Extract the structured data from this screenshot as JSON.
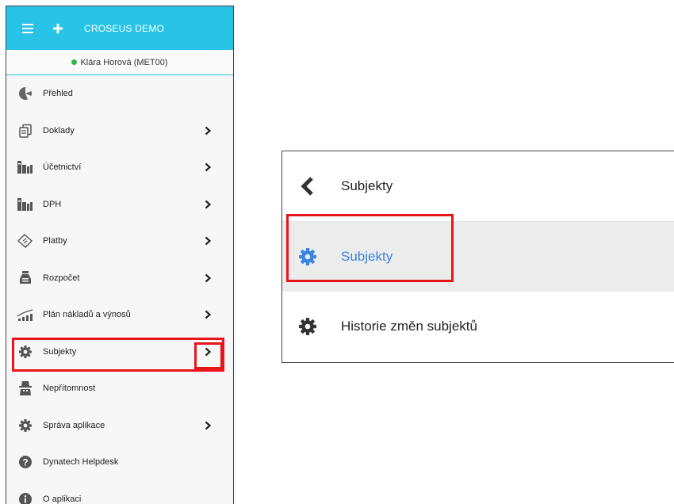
{
  "app": {
    "brand": "CROSEUS DEMO",
    "user": "Klára Horová (MET00)",
    "accent": "#29c3e7",
    "online_color": "#2db74a",
    "highlight_color": "#e8141c"
  },
  "sidebar": {
    "items": [
      {
        "label": "Přehled",
        "icon": "pie-chart-icon",
        "has_submenu": false
      },
      {
        "label": "Doklady",
        "icon": "documents-icon",
        "has_submenu": true
      },
      {
        "label": "Účetnictví",
        "icon": "books-icon",
        "has_submenu": true
      },
      {
        "label": "DPH",
        "icon": "books-icon",
        "has_submenu": true
      },
      {
        "label": "Platby",
        "icon": "payment-icon",
        "has_submenu": true
      },
      {
        "label": "Rozpočet",
        "icon": "money-bag-icon",
        "has_submenu": true
      },
      {
        "label": "Plán nákladů a výnosů",
        "icon": "chart-growth-icon",
        "has_submenu": true
      },
      {
        "label": "Subjekty",
        "icon": "gear-icon",
        "has_submenu": true
      },
      {
        "label": "Nepřítomnost",
        "icon": "incognito-icon",
        "has_submenu": false
      },
      {
        "label": "Správa aplikace",
        "icon": "gear-icon",
        "has_submenu": true
      },
      {
        "label": "Dynatech Helpdesk",
        "icon": "question-icon",
        "has_submenu": false
      },
      {
        "label": "O aplikaci",
        "icon": "info-icon",
        "has_submenu": false
      }
    ]
  },
  "submenu": {
    "title": "Subjekty",
    "items": [
      {
        "label": "Subjekty",
        "icon": "gear-icon",
        "active": true
      },
      {
        "label": "Historie změn subjektů",
        "icon": "gear-icon",
        "active": false
      }
    ]
  }
}
